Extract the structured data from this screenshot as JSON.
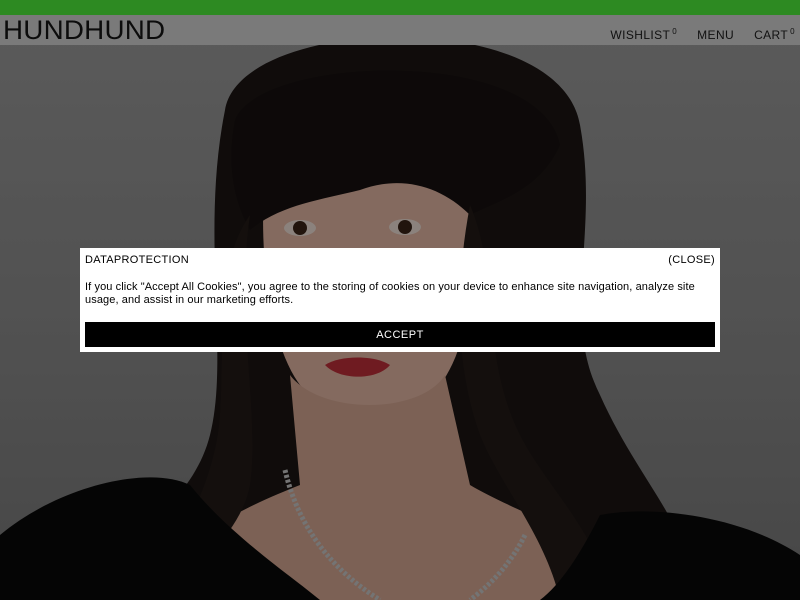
{
  "header": {
    "logo": "HUNDHUND",
    "nav": {
      "wishlist_label": "WISHLIST",
      "wishlist_count": "0",
      "menu_label": "MENU",
      "cart_label": "CART",
      "cart_count": "0"
    }
  },
  "cookie_banner": {
    "title": "DATAPROTECTION",
    "close_label": "(CLOSE)",
    "message": "If you click \"Accept All Cookies\", you agree to the storing of cookies on your device to enhance site navigation, analyze site usage, and assist in our marketing efforts.",
    "accept_label": "ACCEPT"
  },
  "colors": {
    "top_strip": "#2d8a22",
    "header_bg": "#7a7a7a",
    "accept_bg": "#000000",
    "modal_bg": "#ffffff"
  }
}
